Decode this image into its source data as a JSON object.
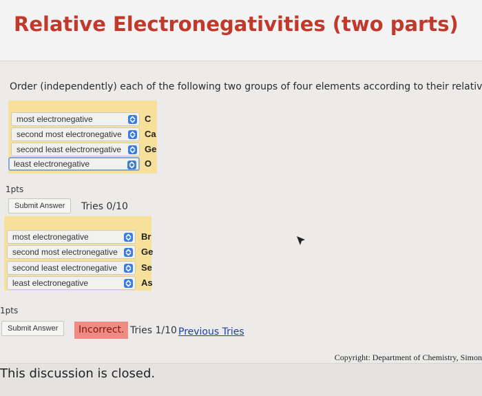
{
  "page": {
    "title": "Relative Electronegativities (two parts)",
    "instructions": "Order (independently) each of the following two groups of four elements according to their relative electr"
  },
  "group1": {
    "rows": [
      {
        "label": "most electronegative",
        "answer": "C"
      },
      {
        "label": "second most electronegative",
        "answer": "Ca"
      },
      {
        "label": "second least electronegative",
        "answer": "Ge"
      },
      {
        "label": "least electronegative",
        "answer": "O"
      }
    ],
    "points": "1pts",
    "submit_label": "Submit Answer",
    "tries": "Tries 0/10"
  },
  "group2": {
    "rows": [
      {
        "label": "most electronegative",
        "answer": "Br"
      },
      {
        "label": "second most electronegative",
        "answer": "Ge"
      },
      {
        "label": "second least electronegative",
        "answer": "Se"
      },
      {
        "label": "least electronegative",
        "answer": "As"
      }
    ],
    "points": "1pts",
    "submit_label": "Submit Answer",
    "feedback": "Incorrect.",
    "tries": "Tries 1/10",
    "previous_tries": "Previous Tries"
  },
  "footer": {
    "copyright": "Copyright: Department of Chemistry, Simon",
    "closed_message": "This discussion is closed."
  },
  "colors": {
    "title": "#c0392b",
    "group_bg": "#f7e09a",
    "stepper": "#3b7ddd",
    "incorrect_bg": "#ef8b83",
    "link": "#1b3fa6"
  }
}
